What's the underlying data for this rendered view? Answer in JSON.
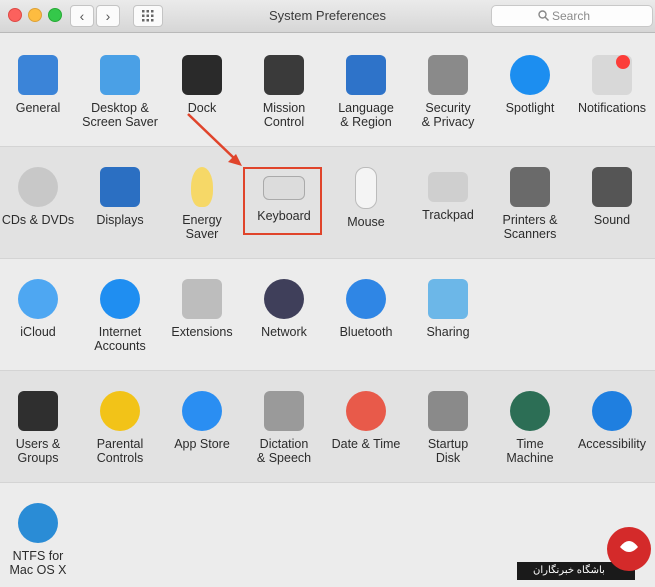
{
  "window": {
    "title": "System Preferences"
  },
  "toolbar": {
    "back": "‹",
    "forward": "›",
    "search_placeholder": "Search"
  },
  "rows": [
    [
      {
        "id": "general",
        "label": "General",
        "icon": "general-icon",
        "color": "#3b84d8"
      },
      {
        "id": "desktop",
        "label": "Desktop &\nScreen Saver",
        "icon": "desktop-screensaver-icon",
        "color": "#4aa0e6"
      },
      {
        "id": "dock",
        "label": "Dock",
        "icon": "dock-icon",
        "color": "#2a2a2a"
      },
      {
        "id": "mission",
        "label": "Mission\nControl",
        "icon": "mission-control-icon",
        "color": "#3a3a3a"
      },
      {
        "id": "language",
        "label": "Language\n& Region",
        "icon": "language-region-icon",
        "color": "#2e73c9"
      },
      {
        "id": "security",
        "label": "Security\n& Privacy",
        "icon": "security-privacy-icon",
        "color": "#8a8a8a"
      },
      {
        "id": "spotlight",
        "label": "Spotlight",
        "icon": "spotlight-icon",
        "color": "#1c8ef0"
      },
      {
        "id": "notifications",
        "label": "Notifications",
        "icon": "notifications-icon",
        "color": "#d8d8d8"
      }
    ],
    [
      {
        "id": "cds",
        "label": "CDs & DVDs",
        "icon": "cds-dvds-icon",
        "color": "#c8c8c8"
      },
      {
        "id": "displays",
        "label": "Displays",
        "icon": "displays-icon",
        "color": "#2b6fc2"
      },
      {
        "id": "energy",
        "label": "Energy\nSaver",
        "icon": "energy-saver-icon",
        "color": "#f6d867"
      },
      {
        "id": "keyboard",
        "label": "Keyboard",
        "icon": "keyboard-icon",
        "color": "#dcdcdc"
      },
      {
        "id": "mouse",
        "label": "Mouse",
        "icon": "mouse-icon",
        "color": "#f4f4f4"
      },
      {
        "id": "trackpad",
        "label": "Trackpad",
        "icon": "trackpad-icon",
        "color": "#cfcfcf"
      },
      {
        "id": "printers",
        "label": "Printers &\nScanners",
        "icon": "printers-scanners-icon",
        "color": "#6a6a6a"
      },
      {
        "id": "sound",
        "label": "Sound",
        "icon": "sound-icon",
        "color": "#555555"
      }
    ],
    [
      {
        "id": "icloud",
        "label": "iCloud",
        "icon": "icloud-icon",
        "color": "#4ea7f2"
      },
      {
        "id": "internet",
        "label": "Internet\nAccounts",
        "icon": "internet-accounts-icon",
        "color": "#1f8ef1"
      },
      {
        "id": "extensions",
        "label": "Extensions",
        "icon": "extensions-icon",
        "color": "#bdbdbd"
      },
      {
        "id": "network",
        "label": "Network",
        "icon": "network-icon",
        "color": "#3f3f5a"
      },
      {
        "id": "bluetooth",
        "label": "Bluetooth",
        "icon": "bluetooth-icon",
        "color": "#2f86e5"
      },
      {
        "id": "sharing",
        "label": "Sharing",
        "icon": "sharing-icon",
        "color": "#6cb7e8"
      }
    ],
    [
      {
        "id": "users",
        "label": "Users &\nGroups",
        "icon": "users-groups-icon",
        "color": "#2f2f2f"
      },
      {
        "id": "parental",
        "label": "Parental\nControls",
        "icon": "parental-controls-icon",
        "color": "#f2c318"
      },
      {
        "id": "appstore",
        "label": "App Store",
        "icon": "app-store-icon",
        "color": "#2a8ef2"
      },
      {
        "id": "dictation",
        "label": "Dictation\n& Speech",
        "icon": "dictation-speech-icon",
        "color": "#9a9a9a"
      },
      {
        "id": "datetime",
        "label": "Date & Time",
        "icon": "date-time-icon",
        "color": "#e85a4a"
      },
      {
        "id": "startup",
        "label": "Startup\nDisk",
        "icon": "startup-disk-icon",
        "color": "#8a8a8a"
      },
      {
        "id": "timemachine",
        "label": "Time\nMachine",
        "icon": "time-machine-icon",
        "color": "#2c6e55"
      },
      {
        "id": "accessibility",
        "label": "Accessibility",
        "icon": "accessibility-icon",
        "color": "#1f7fe0"
      }
    ],
    [
      {
        "id": "ntfs",
        "label": "NTFS for\nMac OS X",
        "icon": "ntfs-icon",
        "color": "#2a8cd6"
      }
    ]
  ],
  "watermark_text": "باشگاه خبرنگاران"
}
